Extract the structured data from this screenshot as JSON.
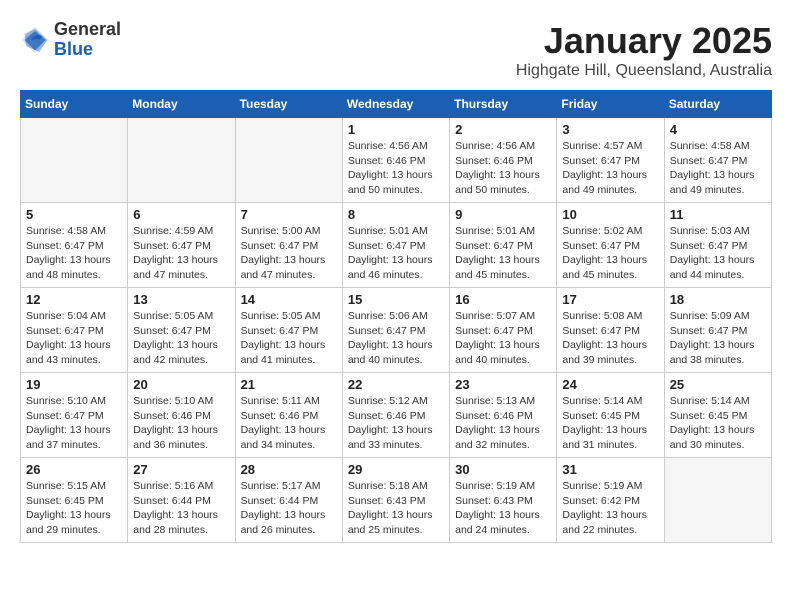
{
  "logo": {
    "general": "General",
    "blue": "Blue"
  },
  "title": "January 2025",
  "location": "Highgate Hill, Queensland, Australia",
  "days_of_week": [
    "Sunday",
    "Monday",
    "Tuesday",
    "Wednesday",
    "Thursday",
    "Friday",
    "Saturday"
  ],
  "weeks": [
    [
      {
        "day": "",
        "info": ""
      },
      {
        "day": "",
        "info": ""
      },
      {
        "day": "",
        "info": ""
      },
      {
        "day": "1",
        "info": "Sunrise: 4:56 AM\nSunset: 6:46 PM\nDaylight: 13 hours\nand 50 minutes."
      },
      {
        "day": "2",
        "info": "Sunrise: 4:56 AM\nSunset: 6:46 PM\nDaylight: 13 hours\nand 50 minutes."
      },
      {
        "day": "3",
        "info": "Sunrise: 4:57 AM\nSunset: 6:47 PM\nDaylight: 13 hours\nand 49 minutes."
      },
      {
        "day": "4",
        "info": "Sunrise: 4:58 AM\nSunset: 6:47 PM\nDaylight: 13 hours\nand 49 minutes."
      }
    ],
    [
      {
        "day": "5",
        "info": "Sunrise: 4:58 AM\nSunset: 6:47 PM\nDaylight: 13 hours\nand 48 minutes."
      },
      {
        "day": "6",
        "info": "Sunrise: 4:59 AM\nSunset: 6:47 PM\nDaylight: 13 hours\nand 47 minutes."
      },
      {
        "day": "7",
        "info": "Sunrise: 5:00 AM\nSunset: 6:47 PM\nDaylight: 13 hours\nand 47 minutes."
      },
      {
        "day": "8",
        "info": "Sunrise: 5:01 AM\nSunset: 6:47 PM\nDaylight: 13 hours\nand 46 minutes."
      },
      {
        "day": "9",
        "info": "Sunrise: 5:01 AM\nSunset: 6:47 PM\nDaylight: 13 hours\nand 45 minutes."
      },
      {
        "day": "10",
        "info": "Sunrise: 5:02 AM\nSunset: 6:47 PM\nDaylight: 13 hours\nand 45 minutes."
      },
      {
        "day": "11",
        "info": "Sunrise: 5:03 AM\nSunset: 6:47 PM\nDaylight: 13 hours\nand 44 minutes."
      }
    ],
    [
      {
        "day": "12",
        "info": "Sunrise: 5:04 AM\nSunset: 6:47 PM\nDaylight: 13 hours\nand 43 minutes."
      },
      {
        "day": "13",
        "info": "Sunrise: 5:05 AM\nSunset: 6:47 PM\nDaylight: 13 hours\nand 42 minutes."
      },
      {
        "day": "14",
        "info": "Sunrise: 5:05 AM\nSunset: 6:47 PM\nDaylight: 13 hours\nand 41 minutes."
      },
      {
        "day": "15",
        "info": "Sunrise: 5:06 AM\nSunset: 6:47 PM\nDaylight: 13 hours\nand 40 minutes."
      },
      {
        "day": "16",
        "info": "Sunrise: 5:07 AM\nSunset: 6:47 PM\nDaylight: 13 hours\nand 40 minutes."
      },
      {
        "day": "17",
        "info": "Sunrise: 5:08 AM\nSunset: 6:47 PM\nDaylight: 13 hours\nand 39 minutes."
      },
      {
        "day": "18",
        "info": "Sunrise: 5:09 AM\nSunset: 6:47 PM\nDaylight: 13 hours\nand 38 minutes."
      }
    ],
    [
      {
        "day": "19",
        "info": "Sunrise: 5:10 AM\nSunset: 6:47 PM\nDaylight: 13 hours\nand 37 minutes."
      },
      {
        "day": "20",
        "info": "Sunrise: 5:10 AM\nSunset: 6:46 PM\nDaylight: 13 hours\nand 36 minutes."
      },
      {
        "day": "21",
        "info": "Sunrise: 5:11 AM\nSunset: 6:46 PM\nDaylight: 13 hours\nand 34 minutes."
      },
      {
        "day": "22",
        "info": "Sunrise: 5:12 AM\nSunset: 6:46 PM\nDaylight: 13 hours\nand 33 minutes."
      },
      {
        "day": "23",
        "info": "Sunrise: 5:13 AM\nSunset: 6:46 PM\nDaylight: 13 hours\nand 32 minutes."
      },
      {
        "day": "24",
        "info": "Sunrise: 5:14 AM\nSunset: 6:45 PM\nDaylight: 13 hours\nand 31 minutes."
      },
      {
        "day": "25",
        "info": "Sunrise: 5:14 AM\nSunset: 6:45 PM\nDaylight: 13 hours\nand 30 minutes."
      }
    ],
    [
      {
        "day": "26",
        "info": "Sunrise: 5:15 AM\nSunset: 6:45 PM\nDaylight: 13 hours\nand 29 minutes."
      },
      {
        "day": "27",
        "info": "Sunrise: 5:16 AM\nSunset: 6:44 PM\nDaylight: 13 hours\nand 28 minutes."
      },
      {
        "day": "28",
        "info": "Sunrise: 5:17 AM\nSunset: 6:44 PM\nDaylight: 13 hours\nand 26 minutes."
      },
      {
        "day": "29",
        "info": "Sunrise: 5:18 AM\nSunset: 6:43 PM\nDaylight: 13 hours\nand 25 minutes."
      },
      {
        "day": "30",
        "info": "Sunrise: 5:19 AM\nSunset: 6:43 PM\nDaylight: 13 hours\nand 24 minutes."
      },
      {
        "day": "31",
        "info": "Sunrise: 5:19 AM\nSunset: 6:42 PM\nDaylight: 13 hours\nand 22 minutes."
      },
      {
        "day": "",
        "info": ""
      }
    ]
  ]
}
